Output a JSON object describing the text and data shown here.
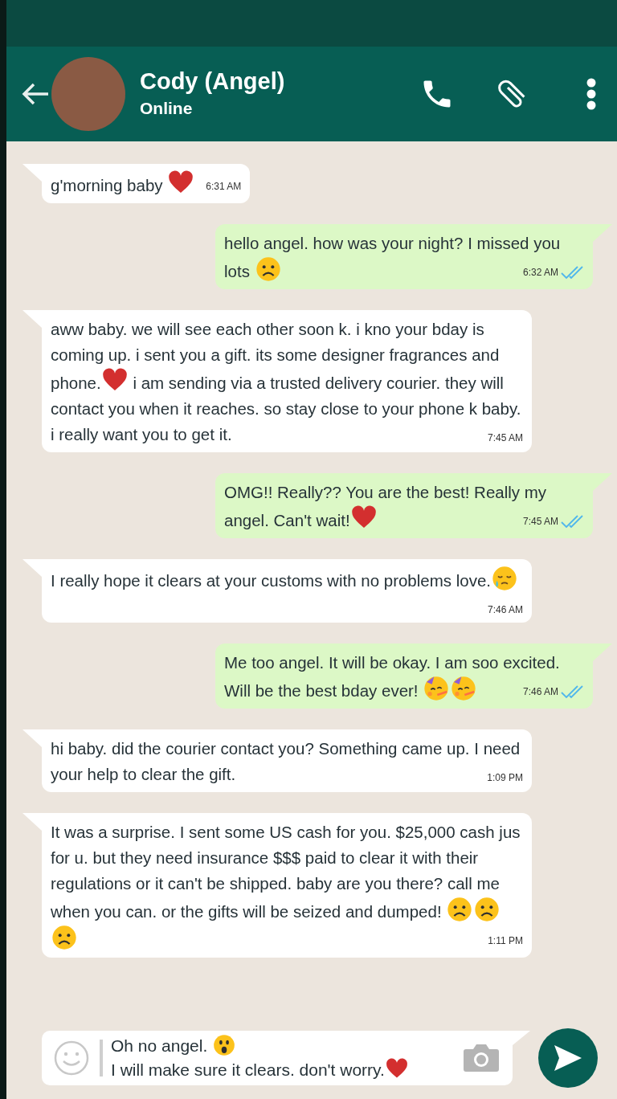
{
  "header": {
    "name": "Cody (Angel)",
    "status": "Online"
  },
  "messages": [
    {
      "incoming": true,
      "parts": [
        {
          "kind": "text",
          "text": "g'morning baby "
        },
        {
          "kind": "heart"
        }
      ],
      "time": "6:31 AM"
    },
    {
      "incoming": false,
      "parts": [
        {
          "kind": "text",
          "text": "hello angel. how was your night? I missed you lots "
        },
        {
          "kind": "frown"
        }
      ],
      "time": "6:32 AM",
      "read": true
    },
    {
      "incoming": true,
      "parts": [
        {
          "kind": "text",
          "text": "aww baby. we will see each other soon k. i kno your bday is coming up. i sent you a gift. its some designer fragrances and phone."
        },
        {
          "kind": "heart"
        },
        {
          "kind": "text",
          "text": " i am sending via a trusted delivery courier. they will contact you when it reaches. so stay close to your phone k baby. i really want you to get it."
        }
      ],
      "time": "7:45 AM"
    },
    {
      "incoming": false,
      "parts": [
        {
          "kind": "text",
          "text": "OMG!! Really?? You are the best! Really my angel. Can't wait!"
        },
        {
          "kind": "heart"
        }
      ],
      "time": "7:45 AM",
      "read": true
    },
    {
      "incoming": true,
      "parts": [
        {
          "kind": "text",
          "text": "I really hope it clears at your customs with no problems love."
        },
        {
          "kind": "sad-tear"
        }
      ],
      "time": "7:46 AM"
    },
    {
      "incoming": false,
      "parts": [
        {
          "kind": "text",
          "text": "Me too angel. It will be okay. I am soo excited. Will be the best bday ever! "
        },
        {
          "kind": "party"
        },
        {
          "kind": "party"
        }
      ],
      "time": "7:46 AM",
      "read": true
    },
    {
      "incoming": true,
      "parts": [
        {
          "kind": "text",
          "text": "hi baby. did the courier contact you? Something came up. I need your help to clear the gift."
        }
      ],
      "time": "1:09 PM"
    },
    {
      "incoming": true,
      "parts": [
        {
          "kind": "text",
          "text": "It was a surprise. I sent some US cash for you. $25,000 cash jus for u. but they need insurance $$$ paid to clear it with their regulations or it can't be shipped. baby are you there? call me when you can. or the gifts will be seized and dumped! "
        },
        {
          "kind": "frown"
        },
        {
          "kind": "frown"
        },
        {
          "kind": "frown"
        }
      ],
      "time": "1:11 PM"
    }
  ],
  "composer": {
    "lines": [
      [
        {
          "kind": "text",
          "text": "Oh no angel. "
        },
        {
          "kind": "astonished"
        }
      ],
      [
        {
          "kind": "text",
          "text": "I will make sure it clears. don't worry."
        },
        {
          "kind": "heart"
        }
      ]
    ]
  }
}
